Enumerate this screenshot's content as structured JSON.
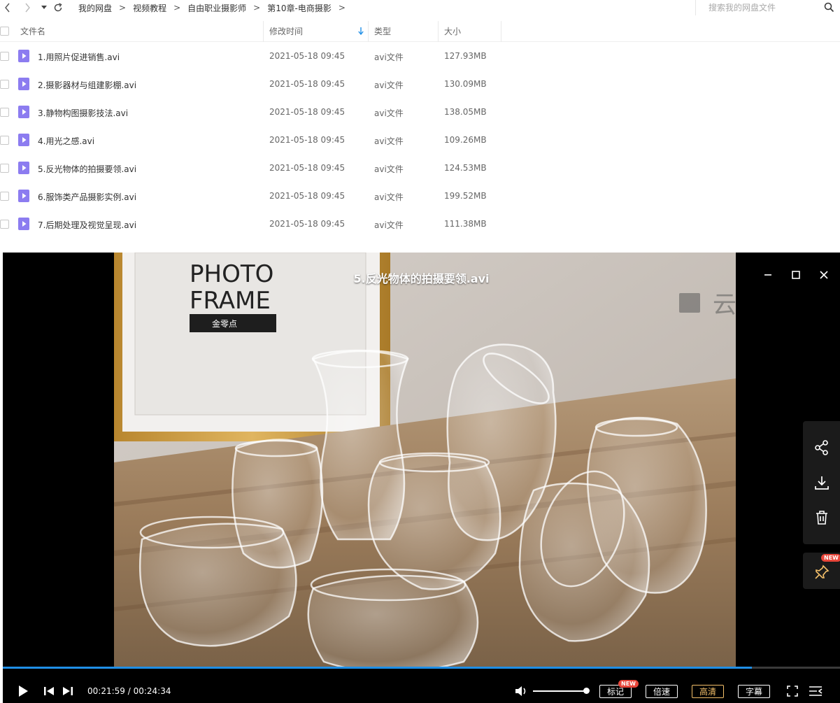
{
  "toolbar": {
    "breadcrumb": [
      "我的网盘",
      "视频教程",
      "自由职业摄影师",
      "第10章-电商摄影"
    ],
    "separator": ">",
    "search_placeholder": "搜索我的网盘文件"
  },
  "table": {
    "headers": {
      "name": "文件名",
      "time": "修改时间",
      "type": "类型",
      "size": "大小"
    },
    "rows": [
      {
        "name": "1.用照片促进销售.avi",
        "time": "2021-05-18 09:45",
        "type": "avi文件",
        "size": "127.93MB"
      },
      {
        "name": "2.摄影器材与组建影棚.avi",
        "time": "2021-05-18 09:45",
        "type": "avi文件",
        "size": "130.09MB"
      },
      {
        "name": "3.静物构图摄影技法.avi",
        "time": "2021-05-18 09:45",
        "type": "avi文件",
        "size": "138.05MB"
      },
      {
        "name": "4.用光之感.avi",
        "time": "2021-05-18 09:45",
        "type": "avi文件",
        "size": "109.26MB"
      },
      {
        "name": "5.反光物体的拍摄要领.avi",
        "time": "2021-05-18 09:45",
        "type": "avi文件",
        "size": "124.53MB"
      },
      {
        "name": "6.服饰类产品摄影实例.avi",
        "time": "2021-05-18 09:45",
        "type": "avi文件",
        "size": "199.52MB"
      },
      {
        "name": "7.后期处理及视觉呈现.avi",
        "time": "2021-05-18 09:45",
        "type": "avi文件",
        "size": "111.38MB"
      }
    ]
  },
  "player": {
    "title": "5.反光物体的拍摄要领.avi",
    "current_time": "00:21:59",
    "duration": "00:24:34",
    "time_separator": " / ",
    "progress_fraction": 0.895,
    "volume_fraction": 1.0,
    "buttons": {
      "mark": "标记",
      "speed": "倍速",
      "quality": "高清",
      "subtitle": "字幕"
    },
    "new_badge": "NEW",
    "video_content": {
      "frame_text_line1": "PHOTO",
      "frame_text_line2": "FRAME",
      "frame_label": "金零点",
      "watermark": "云"
    },
    "colors": {
      "progress": "#1f8fe6",
      "active_quality": "#f4c06a",
      "badge": "#e8463a"
    },
    "icons": [
      "minimize-icon",
      "maximize-icon",
      "close-icon",
      "share-icon",
      "download-icon",
      "trash-icon",
      "pin-icon",
      "play-icon",
      "prev-icon",
      "next-icon",
      "volume-icon",
      "fullscreen-icon",
      "playlist-icon"
    ]
  }
}
